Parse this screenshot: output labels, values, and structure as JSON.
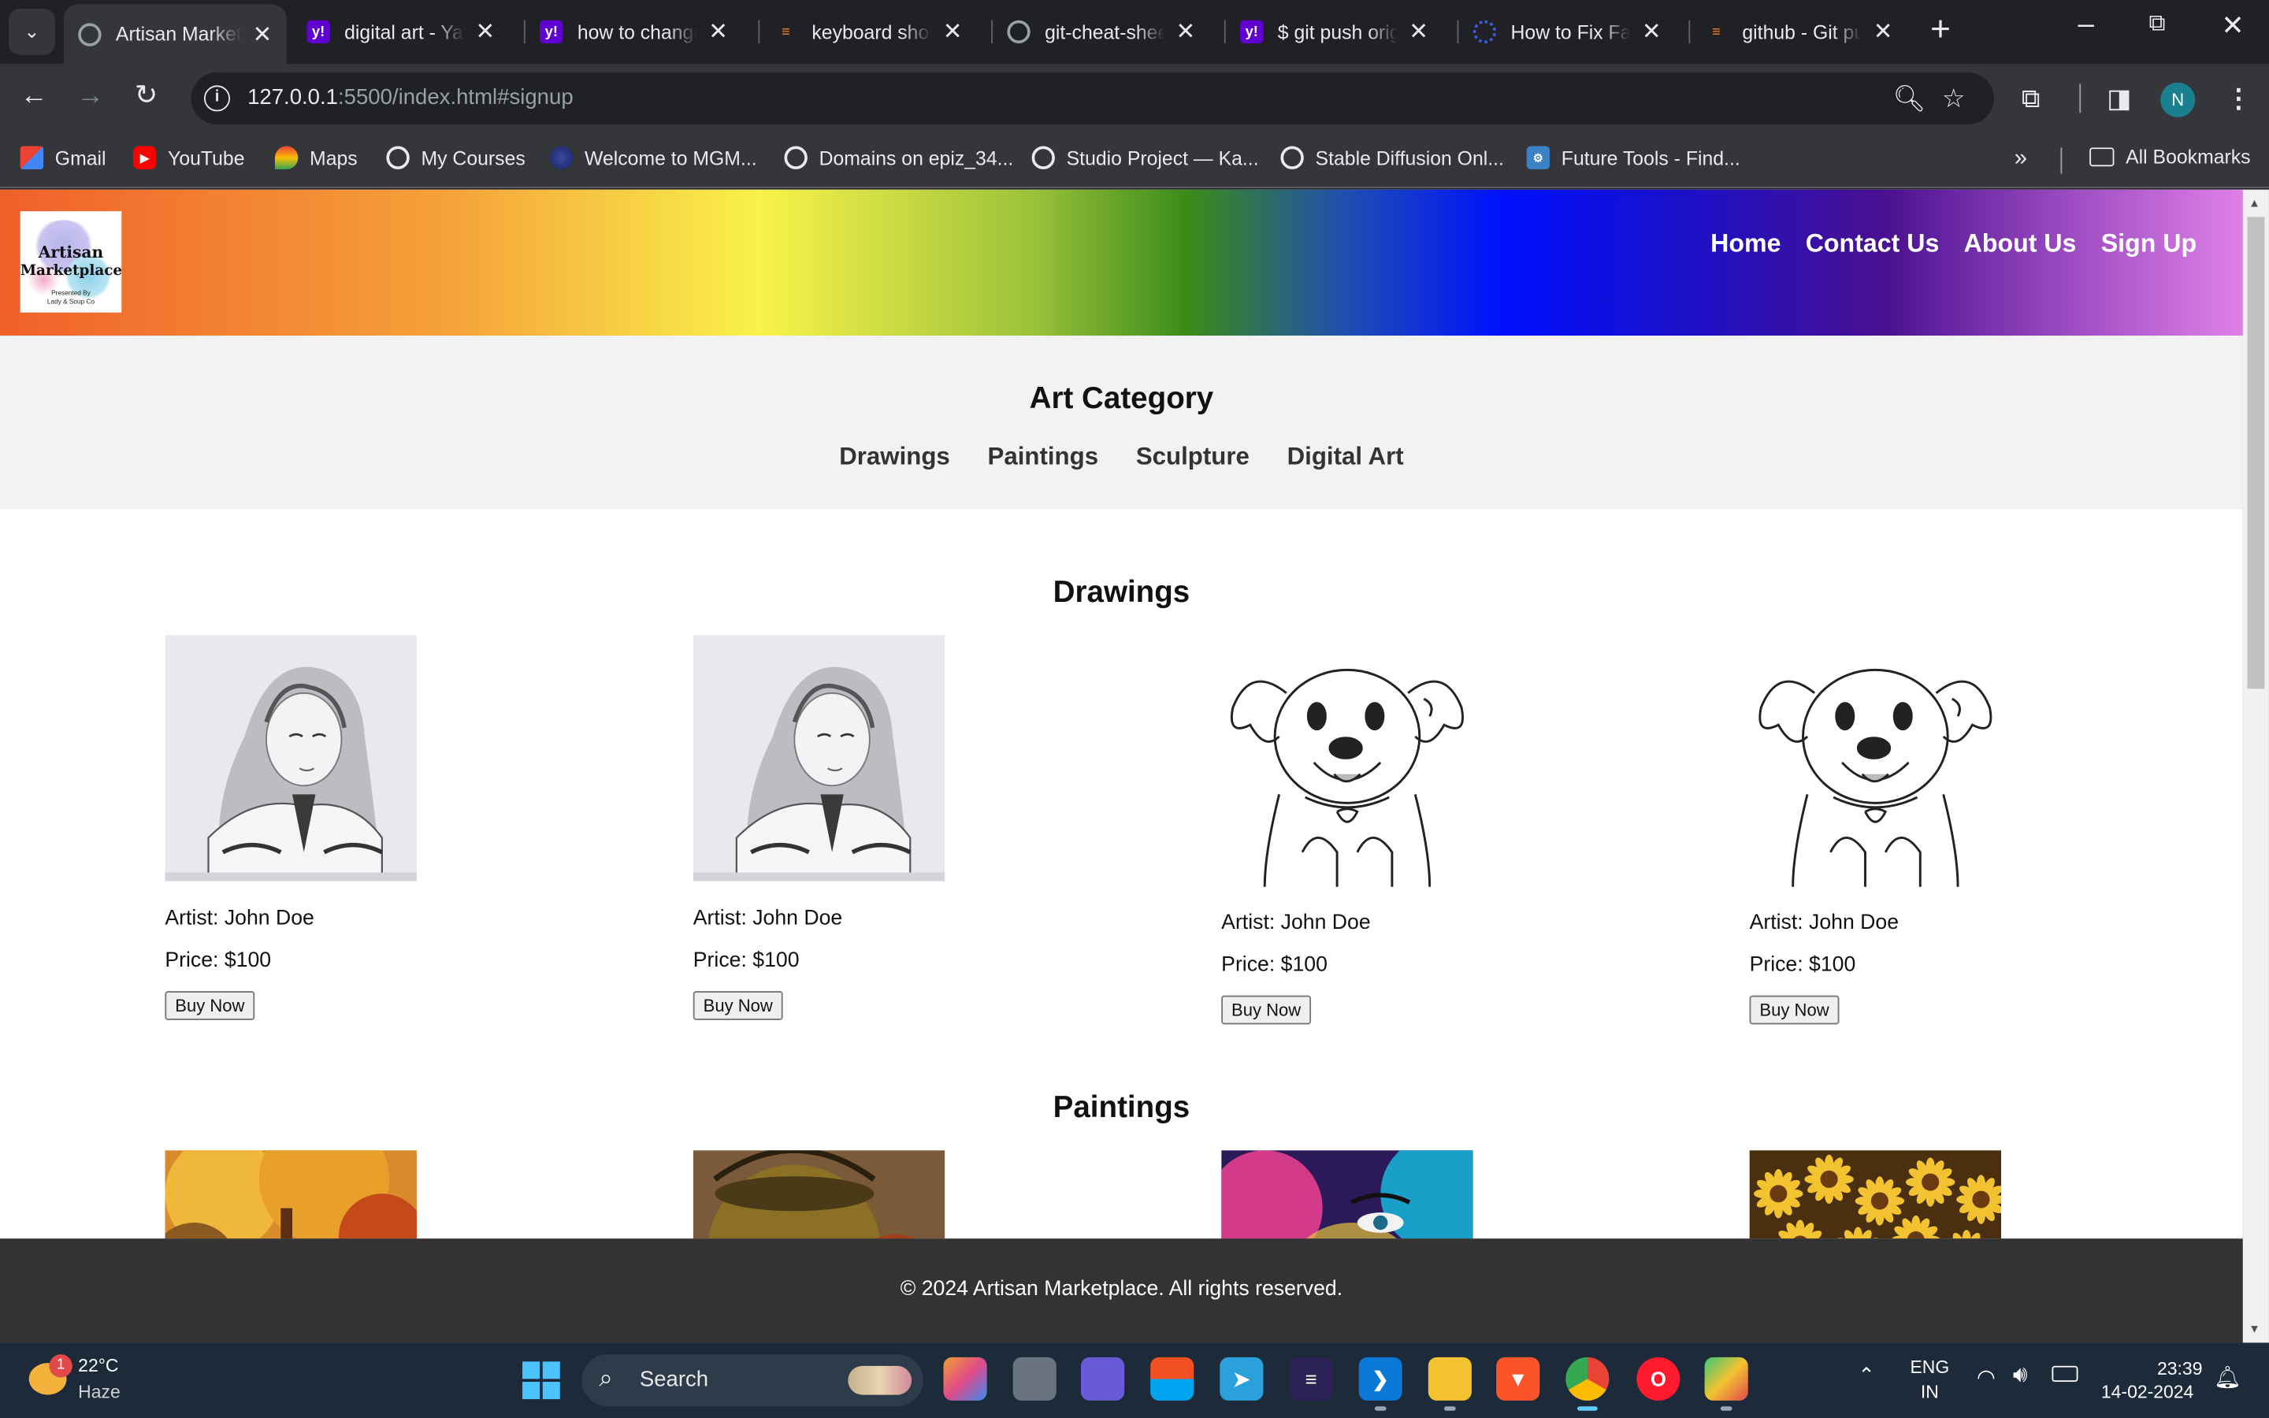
{
  "browser": {
    "tabs": [
      {
        "title": "Artisan Market",
        "fav": "globe-icon",
        "favColor": "#9aa0a6",
        "active": true
      },
      {
        "title": "digital art - Yah",
        "fav": "yahoo-icon",
        "favColor": "#6001d2"
      },
      {
        "title": "how to change",
        "fav": "yahoo-icon",
        "favColor": "#6001d2"
      },
      {
        "title": "keyboard shor",
        "fav": "stackoverflow-icon",
        "favColor": "#f48024"
      },
      {
        "title": "git-cheat-shee",
        "fav": "globe-icon",
        "favColor": "#9aa0a6"
      },
      {
        "title": "$ git push orig",
        "fav": "yahoo-icon",
        "favColor": "#6001d2"
      },
      {
        "title": "How to Fix Fat",
        "fav": "blue-globe-icon",
        "favColor": "#3b5bdb"
      },
      {
        "title": "github - Git pu",
        "fav": "stackoverflow-icon",
        "favColor": "#f48024"
      }
    ],
    "url_host": "127.0.0.1",
    "url_path": ":5500/index.html#signup",
    "profile_initial": "N",
    "bookmarks": [
      {
        "label": "Gmail",
        "icon": "gmail-icon"
      },
      {
        "label": "YouTube",
        "icon": "youtube-icon"
      },
      {
        "label": "Maps",
        "icon": "maps-icon"
      },
      {
        "label": "My Courses",
        "icon": "globe-icon"
      },
      {
        "label": "Welcome to MGM...",
        "icon": "mgm-icon"
      },
      {
        "label": "Domains on epiz_34...",
        "icon": "globe-icon"
      },
      {
        "label": "Studio Project — Ka...",
        "icon": "globe-icon"
      },
      {
        "label": "Stable Diffusion Onl...",
        "icon": "globe-icon"
      },
      {
        "label": "Future Tools - Find...",
        "icon": "future-tools-icon"
      }
    ],
    "all_bookmarks": "All Bookmarks"
  },
  "site": {
    "logo": {
      "line1": "Artisan",
      "line2": "Marketplace",
      "line3a": "Presented By",
      "line3b": "Lady & Soup Co"
    },
    "nav": [
      "Home",
      "Contact Us",
      "About Us",
      "Sign Up"
    ],
    "category_title": "Art Category",
    "categories": [
      "Drawings",
      "Paintings",
      "Sculpture",
      "Digital Art"
    ],
    "drawings_title": "Drawings",
    "paintings_title": "Paintings",
    "drawings": [
      {
        "artist": "Artist: John Doe",
        "price": "Price: $100",
        "button": "Buy Now",
        "image": "girl-pencil-sketch"
      },
      {
        "artist": "Artist: John Doe",
        "price": "Price: $100",
        "button": "Buy Now",
        "image": "girl-pencil-sketch"
      },
      {
        "artist": "Artist: John Doe",
        "price": "Price: $100",
        "button": "Buy Now",
        "image": "puppy-line-drawing"
      },
      {
        "artist": "Artist: John Doe",
        "price": "Price: $100",
        "button": "Buy Now",
        "image": "puppy-line-drawing"
      }
    ],
    "paintings": [
      {
        "image": "autumn-tree-painting"
      },
      {
        "image": "brass-pot-painting"
      },
      {
        "image": "colorful-face-painting"
      },
      {
        "image": "sunflowers-painting"
      }
    ],
    "footer": "© 2024 Artisan Marketplace. All rights reserved."
  },
  "taskbar": {
    "notification_count": "1",
    "temperature": "22°C",
    "weather": "Haze",
    "search": "Search",
    "lang1": "ENG",
    "lang2": "IN",
    "time": "23:39",
    "date": "14-02-2024"
  }
}
